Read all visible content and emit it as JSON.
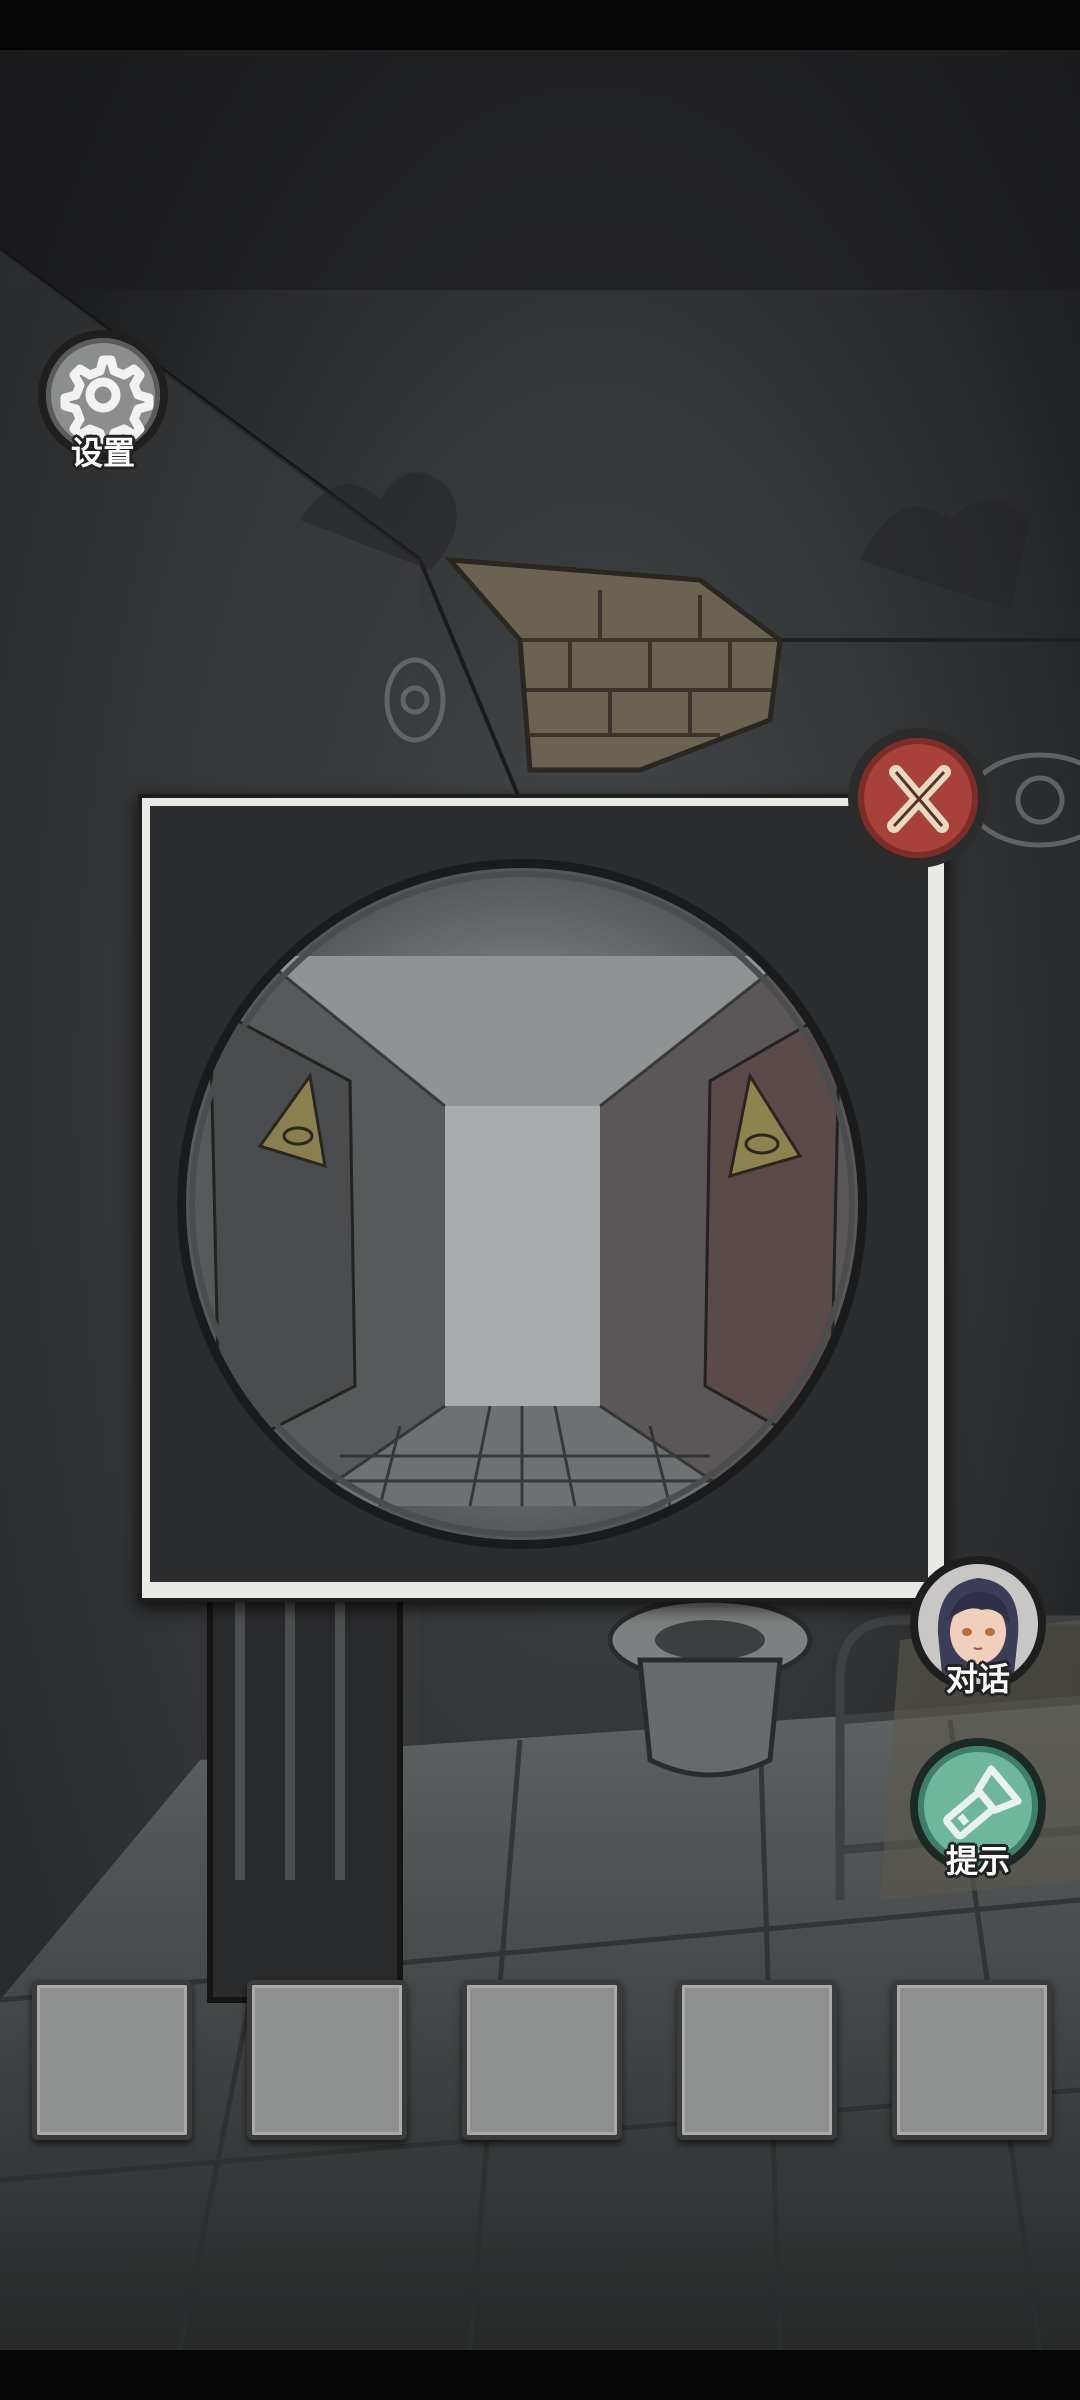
{
  "hud": {
    "settings_label": "设置",
    "dialogue_label": "对话",
    "hint_label": "提示"
  },
  "icons": {
    "settings": "gear-icon",
    "close": "close-x-icon",
    "dialogue": "character-portrait-icon",
    "hint": "flashlight-icon"
  },
  "inventory": {
    "slots": [
      "",
      "",
      "",
      "",
      ""
    ]
  },
  "colors": {
    "close_button": "#a8413a",
    "hint_button": "#6fb79c",
    "popup_frame": "#e9e9e6",
    "slot_fill": "#8e8f8f"
  }
}
